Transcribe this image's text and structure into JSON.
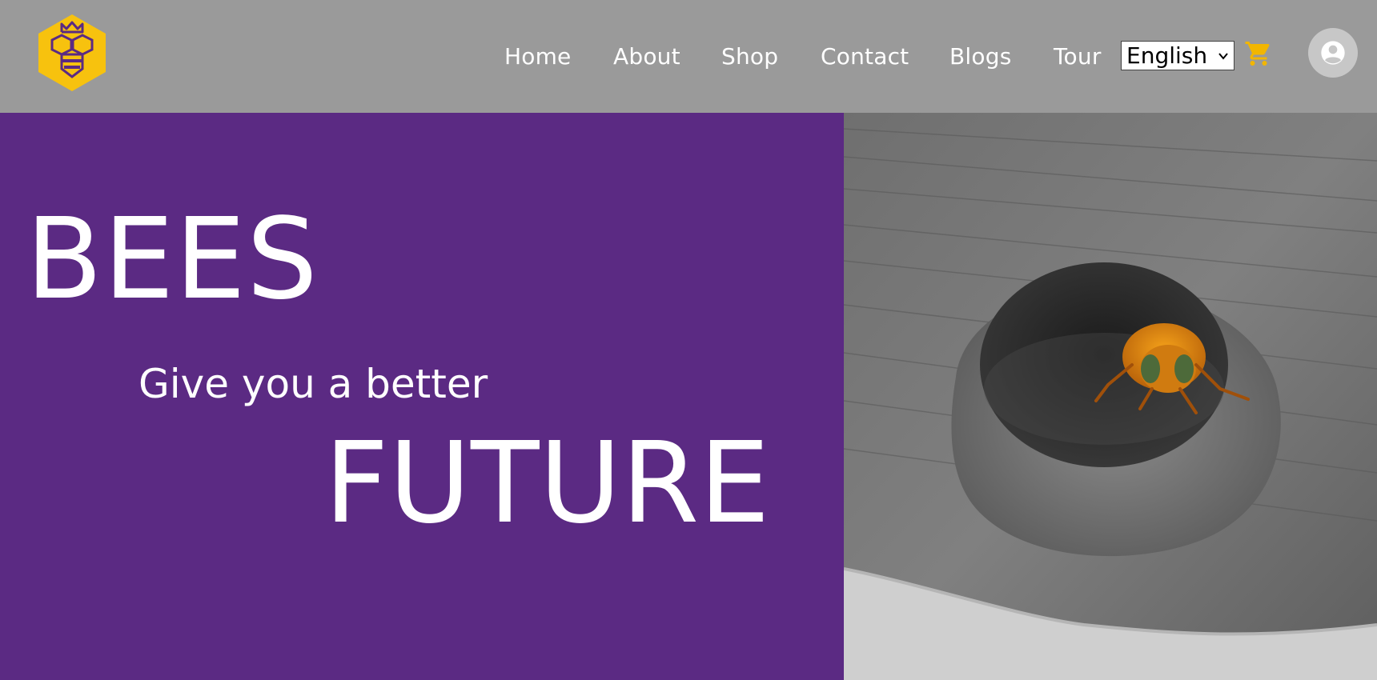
{
  "header": {
    "logo_icon": "queen-bee-hexagon-logo",
    "colors": {
      "background": "#9a9a9a",
      "logo_yellow": "#f7c20e",
      "logo_purple": "#5b2a83",
      "cart": "#f2b600"
    },
    "nav": [
      {
        "label": "Home"
      },
      {
        "label": "About"
      },
      {
        "label": "Shop"
      },
      {
        "label": "Contact"
      },
      {
        "label": "Blogs"
      },
      {
        "label": "Tour"
      }
    ],
    "language": {
      "selected": "English"
    },
    "cart_icon": "shopping-cart-icon",
    "account_icon": "user-circle-icon"
  },
  "hero": {
    "title": "BEES",
    "subtitle": "Give you a better",
    "highlight": "FUTURE",
    "background_color": "#5b2a83",
    "image_description_icon": "bee-in-wood-hole-photo"
  }
}
